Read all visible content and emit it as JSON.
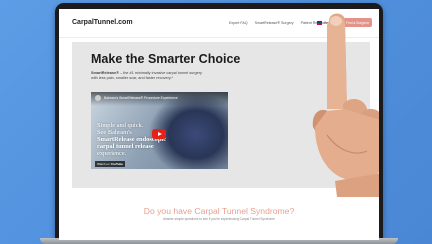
{
  "site": {
    "logo_text": "CarpalTunnel.com"
  },
  "nav": {
    "links": [
      "Expert FAQ",
      "SmartRelease® Surgery",
      "Patient Resources"
    ],
    "language": "English",
    "cta": "Find a Surgeon"
  },
  "hero": {
    "title": "Make the Smarter Choice",
    "desc_brand": "SmartRelease®",
    "desc_rest": " – the #1 minimally invasive carpal tunnel surgery with less pain, smaller scar, and faster recovery.*"
  },
  "video": {
    "title": "Bahram's SmartRelease® Procedure Experience",
    "overlay_line1": "Simple and quick.",
    "overlay_line2": "See Bahram's",
    "overlay_bold": "SmartRelease endoscopic carpal tunnel release",
    "overlay_line3": "experience.",
    "watch_on": "Watch on",
    "yt_label": "YouTube"
  },
  "section": {
    "title": "Do you have Carpal Tunnel Syndrome?",
    "subtitle": "Answer simple questions to see if you're experiencing Carpal Tunnel Syndrome"
  },
  "colors": {
    "background": "#4f8fdc",
    "accent": "#e4938a",
    "youtube_red": "#e62117"
  }
}
